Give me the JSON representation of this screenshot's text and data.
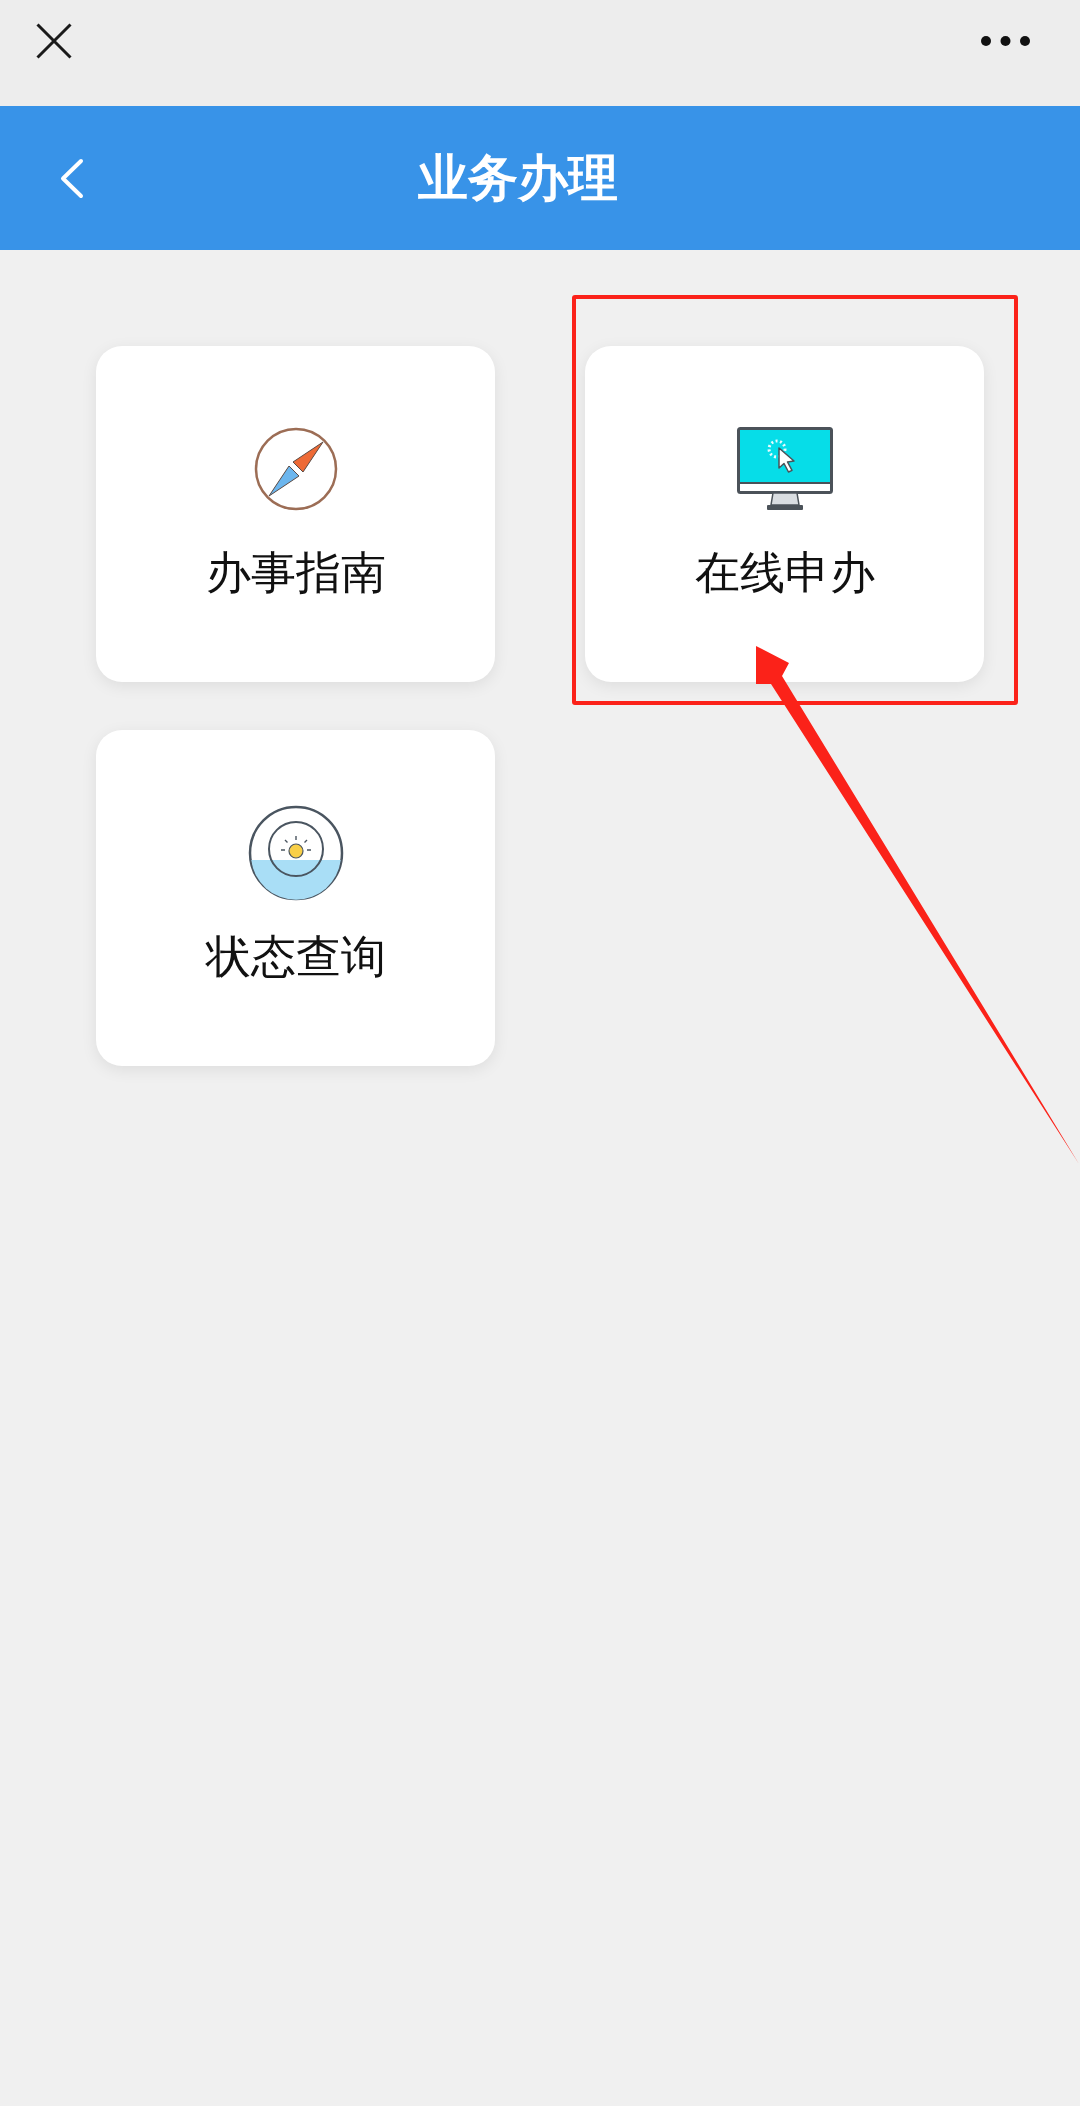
{
  "header": {
    "title": "业务办理"
  },
  "cards": [
    {
      "label": "办事指南",
      "highlighted": false,
      "pointed": false
    },
    {
      "label": "在线申办",
      "highlighted": true,
      "pointed": true
    },
    {
      "label": "状态查询",
      "highlighted": false,
      "pointed": false
    }
  ]
}
